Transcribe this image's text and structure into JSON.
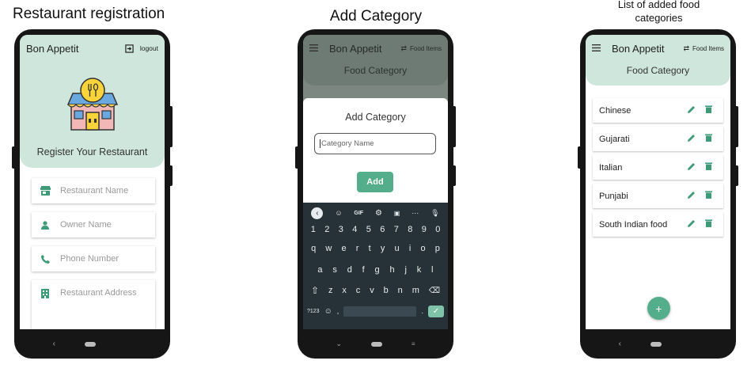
{
  "captions": {
    "left": "Restaurant registration",
    "middle": "Add Category",
    "right_line1": "List of added food",
    "right_line2": "categories"
  },
  "phone1": {
    "app_title": "Bon Appetit",
    "logout_label": "logout",
    "heading": "Register Your Restaurant",
    "fields": {
      "restaurant_name": "Restaurant Name",
      "owner_name": "Owner Name",
      "phone_number": "Phone Number",
      "restaurant_address": "Restaurant Address"
    }
  },
  "phone2": {
    "app_title": "Bon Appetit",
    "food_items_label": "Food Items",
    "section_title": "Food Category",
    "dialog_title": "Add Category",
    "input_placeholder": "Category Name",
    "add_button": "Add",
    "keyboard": {
      "toolbar": [
        "GIF"
      ],
      "row_numbers": [
        "1",
        "2",
        "3",
        "4",
        "5",
        "6",
        "7",
        "8",
        "9",
        "0"
      ],
      "row1": [
        "q",
        "w",
        "e",
        "r",
        "t",
        "y",
        "u",
        "i",
        "o",
        "p"
      ],
      "row2": [
        "a",
        "s",
        "d",
        "f",
        "g",
        "h",
        "j",
        "k",
        "l"
      ],
      "row3": [
        "z",
        "x",
        "c",
        "v",
        "b",
        "n",
        "m"
      ],
      "symbols_key": "?123",
      "comma": ",",
      "period": "."
    }
  },
  "phone3": {
    "app_title": "Bon Appetit",
    "food_items_label": "Food Items",
    "section_title": "Food Category",
    "categories": [
      "Chinese",
      "Gujarati",
      "Italian",
      "Punjabi",
      "South Indian food"
    ],
    "fab_label": "+"
  },
  "colors": {
    "mint": "#cfe6dc",
    "accent_green": "#3e9b78",
    "add_button": "#55ae8b",
    "keyboard_bg": "#263238"
  }
}
